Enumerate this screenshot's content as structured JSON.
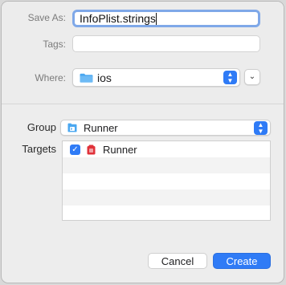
{
  "save_as": {
    "label": "Save As:",
    "value": "InfoPlist.strings"
  },
  "tags": {
    "label": "Tags:",
    "value": ""
  },
  "where": {
    "label": "Where:",
    "value": "ios"
  },
  "group": {
    "label": "Group",
    "value": "Runner"
  },
  "targets": {
    "label": "Targets",
    "items": [
      {
        "name": "Runner",
        "checked": true
      }
    ]
  },
  "buttons": {
    "cancel": "Cancel",
    "create": "Create"
  },
  "colors": {
    "accent": "#2f7bf6",
    "focus_ring": "#7fa8e8",
    "folder": "#4aa7f0",
    "target_icon": "#e0323a"
  }
}
